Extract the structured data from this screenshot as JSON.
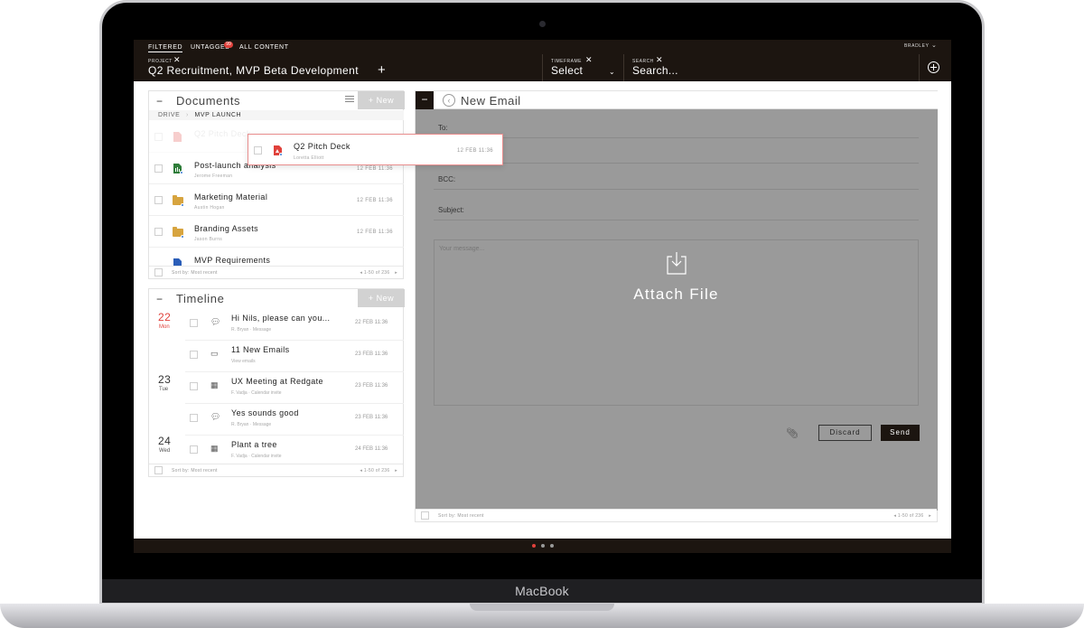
{
  "device": {
    "label": "MacBook"
  },
  "topbar": {
    "tabs": [
      {
        "label": "FILTERED",
        "active": true
      },
      {
        "label": "UNTAGGED",
        "badge": "99"
      },
      {
        "label": "ALL CONTENT"
      }
    ],
    "project": {
      "label": "PROJECT",
      "value": "Q2 Recruitment, MVP Beta Development"
    },
    "timeframe": {
      "label": "TIMEFRAME",
      "value": "Select"
    },
    "search": {
      "label": "SEARCH",
      "placeholder": "Search..."
    },
    "user": "BRADLEY"
  },
  "documents": {
    "title": "Documents",
    "new_label": "+ New",
    "breadcrumb": [
      "DRIVE",
      "MVP LAUNCH"
    ],
    "rows": [
      {
        "title": "Q2 Pitch Deck",
        "sub": "",
        "date": "",
        "icon": "pdf-icon",
        "ghost": true
      },
      {
        "title": "Post-launch analysis",
        "sub": "Jerome Freeman",
        "date": "12 FEB 11:36",
        "icon": "spreadsheet-icon"
      },
      {
        "title": "Marketing Material",
        "sub": "Austin Hogan",
        "date": "12 FEB 11:36",
        "icon": "folder-icon"
      },
      {
        "title": "Branding Assets",
        "sub": "Jason Burns",
        "date": "12 FEB 11:36",
        "icon": "folder-icon"
      },
      {
        "title": "MVP Requirements",
        "sub": "",
        "date": "",
        "icon": "doc-icon"
      }
    ],
    "footer": {
      "sort": "Sort by: Most recent",
      "pager": "1-50 of 236"
    }
  },
  "drag_preview": {
    "title": "Q2 Pitch Deck",
    "sub": "Loretta Elliott",
    "date": "12 FEB 11:36"
  },
  "timeline": {
    "title": "Timeline",
    "new_label": "+ New",
    "days": [
      {
        "num": "22",
        "name": "Mon",
        "red": true
      },
      {
        "num": "23",
        "name": "Tue"
      },
      {
        "num": "24",
        "name": "Wed"
      }
    ],
    "items": [
      {
        "title": "Hi Nils, please can you...",
        "sub": "R. Bryan · Message",
        "date": "22 FEB 11:36",
        "icon": "chat-icon"
      },
      {
        "title": "11 New Emails",
        "sub": "View emails",
        "date": "23 FEB 11:36",
        "icon": "inbox-icon"
      },
      {
        "title": "UX Meeting at Redgate",
        "sub": "F. Vadja · Calendar invite",
        "date": "23 FEB 11:36",
        "icon": "calendar-icon"
      },
      {
        "title": "Yes sounds good",
        "sub": "R. Bryan · Message",
        "date": "23 FEB 11:36",
        "icon": "chat-icon"
      },
      {
        "title": "Plant a tree",
        "sub": "F. Vadja · Calendar invite",
        "date": "24 FEB 11:36",
        "icon": "calendar-icon"
      }
    ],
    "footer": {
      "sort": "Sort by: Most recent",
      "pager": "1-50 of 236"
    }
  },
  "email": {
    "title": "New Email",
    "to_label": "To:",
    "cc_label": "",
    "bcc_label": "BCC:",
    "subject_label": "Subject:",
    "message_placeholder": "Your message...",
    "attach_label": "Attach File",
    "discard_label": "Discard",
    "send_label": "Send",
    "footer": {
      "sort": "Sort by: Most recent",
      "pager": "1-50 of 236"
    }
  },
  "colors": {
    "accent": "#e0413b",
    "dark": "#1c1510",
    "overlay": "#9a9a9a"
  }
}
